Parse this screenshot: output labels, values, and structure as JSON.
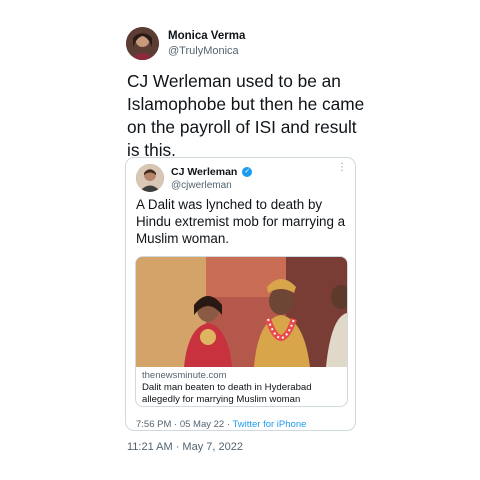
{
  "tweet": {
    "author_name": "Monica Verma",
    "author_handle": "@TrulyMonica",
    "text": "CJ Werleman used to be an Islamophobe but then he came on the payroll of ISI and result is this.",
    "timestamp": "11:21 AM · May 7, 2022"
  },
  "quoted_tweet": {
    "author_name": "CJ Werleman",
    "author_handle": "@cjwerleman",
    "more_glyph": "⋮",
    "verified_glyph": "✓",
    "text": "A Dalit was lynched to death by Hindu extremist mob for marrying a Muslim woman.",
    "link_card": {
      "domain": "thenewsminute.com",
      "title": "Dalit man beaten to death in Hyderabad allegedly for marrying Muslim woman"
    },
    "time": "7:56 PM · 05 May 22",
    "separator": " · ",
    "source": "Twitter for iPhone"
  },
  "colors": {
    "link_blue": "#1d9bf0",
    "secondary_text": "#536471",
    "border": "#cfd9de"
  }
}
